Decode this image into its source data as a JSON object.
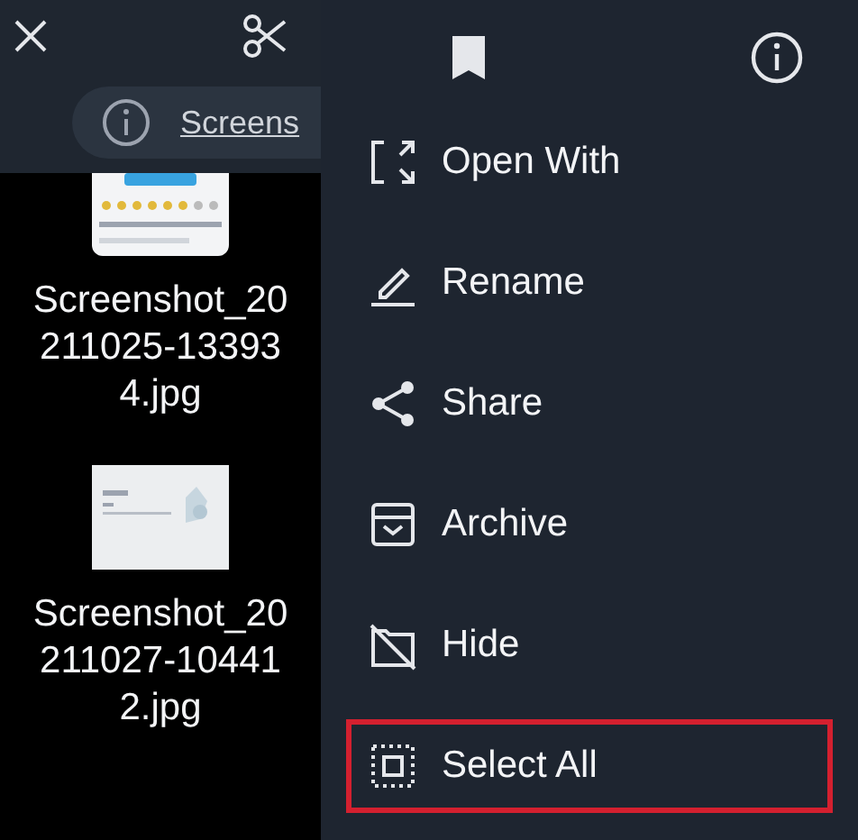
{
  "info_bar": {
    "link": "Screens"
  },
  "files": [
    {
      "kind": "picture",
      "name": "Screenshot_20211025-133934.jpg"
    },
    {
      "kind": "picture",
      "name": "Screenshot_20211027-104412.jpg"
    }
  ],
  "menu": [
    {
      "kind": "open-with",
      "label": "Open With",
      "highlighted": false
    },
    {
      "kind": "rename",
      "label": "Rename",
      "highlighted": false
    },
    {
      "kind": "share",
      "label": "Share",
      "highlighted": false
    },
    {
      "kind": "archive",
      "label": "Archive",
      "highlighted": false
    },
    {
      "kind": "hide",
      "label": "Hide",
      "highlighted": false
    },
    {
      "kind": "select-all",
      "label": "Select All",
      "highlighted": true
    }
  ]
}
